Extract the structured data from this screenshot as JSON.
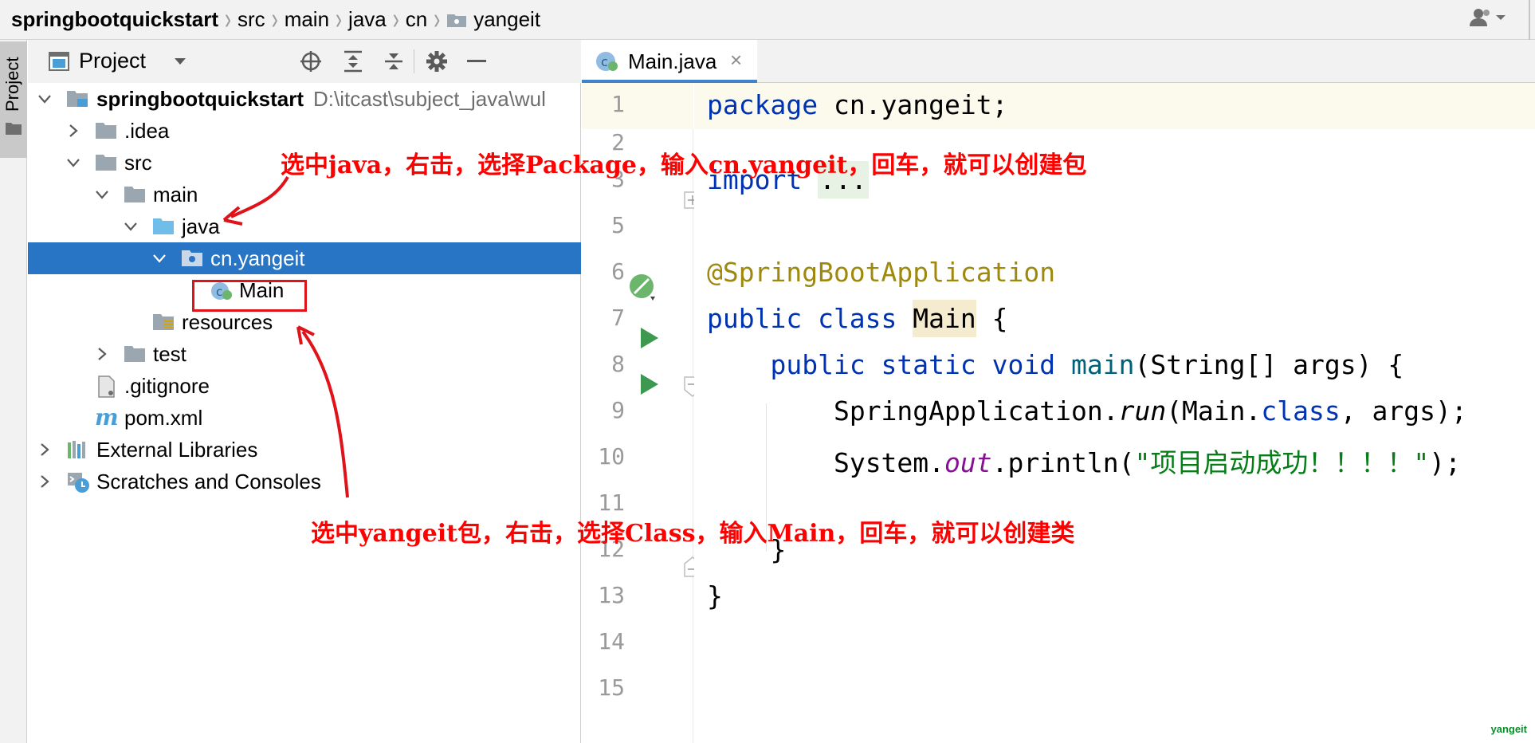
{
  "breadcrumb": {
    "items": [
      "springbootquickstart",
      "src",
      "main",
      "java",
      "cn",
      "yangeit"
    ]
  },
  "tool_strip": {
    "project_tab_label": "Project"
  },
  "project_panel": {
    "title": "Project",
    "tree": [
      {
        "label": "springbootquickstart",
        "path": "D:\\itcast\\subject_java\\wul"
      },
      {
        "label": ".idea"
      },
      {
        "label": "src"
      },
      {
        "label": "main"
      },
      {
        "label": "java"
      },
      {
        "label": "cn.yangeit"
      },
      {
        "label": "Main"
      },
      {
        "label": "resources"
      },
      {
        "label": "test"
      },
      {
        "label": ".gitignore"
      },
      {
        "label": "pom.xml"
      },
      {
        "label": "External Libraries"
      },
      {
        "label": "Scratches and Consoles"
      }
    ]
  },
  "editor": {
    "tab_label": "Main.java",
    "tab_close": "×",
    "line_numbers": [
      "1",
      "3",
      "5",
      "6",
      "7",
      "8",
      "9",
      "10",
      "11",
      "12",
      "13",
      "14",
      "15"
    ],
    "code": {
      "l1_kw": "package",
      "l1_rest": " cn.yangeit;",
      "l3_kw": "import",
      "l3_fold": "...",
      "l6_anno": "@SpringBootApplication",
      "l7_kw": "public class",
      "l7_class": "Main",
      "l7_rest": " {",
      "l8_kw": "public static void",
      "l8_fn": "main",
      "l8_rest": "(String[] args) {",
      "l9_a": "SpringApplication.",
      "l9_run": "run",
      "l9_b": "(Main.",
      "l9_class": "class",
      "l9_c": ", args);",
      "l10_a": "System.",
      "l10_out": "out",
      "l10_b": ".println(",
      "l10_str": "\"项目启动成功！！！！\"",
      "l10_c": ");",
      "l12": "}",
      "l13": "}"
    }
  },
  "annotations": {
    "top": "选中java，右击，选择Package，输入cn.yangeit，回车，就可以创建包",
    "bottom": "选中yangeit包，右击，选择Class，输入Main，回车，就可以创建类"
  },
  "watermark": "yangeit",
  "colors": {
    "selection": "#2775c4",
    "annotation": "#ff0000",
    "keyword": "#0033b3",
    "annotation_code": "#9e880d",
    "string": "#067d17"
  }
}
